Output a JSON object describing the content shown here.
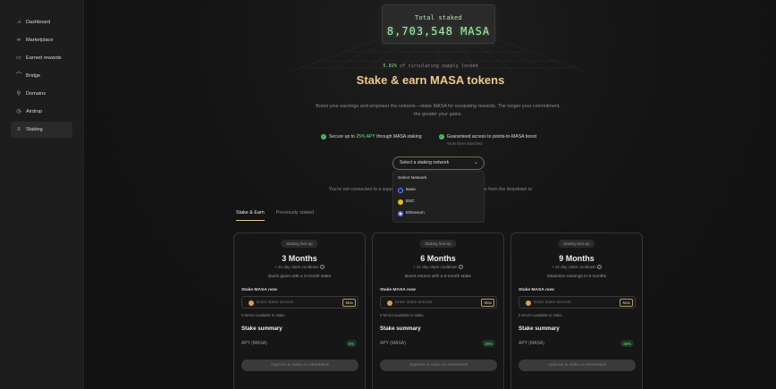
{
  "sidebar": {
    "items": [
      {
        "label": "Dashboard",
        "icon": "chart-icon"
      },
      {
        "label": "Marketplace",
        "icon": "link-icon"
      },
      {
        "label": "Earned rewards",
        "icon": "wallet-icon"
      },
      {
        "label": "Bridge",
        "icon": "bridge-icon"
      },
      {
        "label": "Domains",
        "icon": "key-icon"
      },
      {
        "label": "Airdrop",
        "icon": "airdrop-icon"
      },
      {
        "label": "Staking",
        "icon": "stack-icon",
        "active": true
      }
    ]
  },
  "hero": {
    "total_label": "Total staked",
    "total_value": "8,703,548 MASA",
    "supply_pct": "5.02%",
    "supply_text": " of circulating supply locked",
    "headline": "Stake & earn MASA tokens",
    "subtitle": "Boost your earnings and empower the network—stake MASA for escalating rewards. The longer your commitment, the greater your gains."
  },
  "features": [
    {
      "prefix": "Secure up to ",
      "accent": "25% APY",
      "suffix": " through MASA staking",
      "sub": ""
    },
    {
      "prefix": "Guaranteed access to points-to-MASA boost",
      "accent": "",
      "suffix": "",
      "sub": "Yours when launched"
    }
  ],
  "network_select": {
    "label": "Select a staking network",
    "dropdown_title": "Select Network",
    "options": [
      {
        "label": "Base",
        "color": "#0f2a7a"
      },
      {
        "label": "BSC",
        "color": "#f0b90b"
      },
      {
        "label": "Ethereum",
        "color": "#627eea"
      }
    ]
  },
  "notice": {
    "text": "You're not connected to a suppo                                                       m or Base from the dropdown to"
  },
  "tabs": [
    {
      "label": "Stake & Earn",
      "active": true
    },
    {
      "label": "Previously staked",
      "active": false
    }
  ],
  "cards": [
    {
      "badge": "Staking lock-up",
      "months": "3 Months",
      "cooldown": "+ 21 day claim cooldown",
      "desc": "Quick gains with a 3-month stake",
      "stake_label": "Stake MASA now",
      "placeholder": "Enter stake amount",
      "max": "Max",
      "available": "0 MASA available to stake",
      "summary": "Stake summary",
      "apy_label": "APY (MASA)",
      "apy": "5%",
      "button": "Approve & stake on MetaMask"
    },
    {
      "badge": "Staking lock-up",
      "months": "6 Months",
      "cooldown": "+ 21 day claim cooldown",
      "desc": "Boost returns with a 6-month stake",
      "stake_label": "Stake MASA now",
      "placeholder": "Enter stake amount",
      "max": "Max",
      "available": "0 MASA available to stake",
      "summary": "Stake summary",
      "apy_label": "APY (MASA)",
      "apy": "20%",
      "button": "Approve & stake on MetaMask"
    },
    {
      "badge": "Staking lock-up",
      "months": "9 Months",
      "cooldown": "+ 21 day claim cooldown",
      "desc": "Maximize earnings in 9 months",
      "stake_label": "Stake MASA now",
      "placeholder": "Enter stake amount",
      "max": "Max",
      "available": "0 MASA available to stake",
      "summary": "Stake summary",
      "apy_label": "APY (MASA)",
      "apy": "25%",
      "button": "Approve & stake on MetaMask"
    }
  ],
  "colors": {
    "accent_gold": "#f2c98c",
    "accent_green": "#6ee07f",
    "background": "#121212"
  }
}
